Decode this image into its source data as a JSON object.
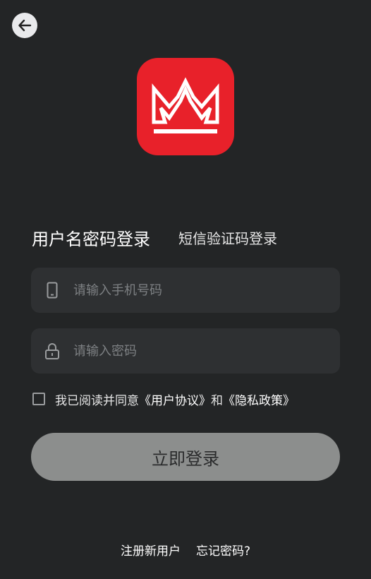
{
  "header": {
    "back_icon": "arrow-left-icon"
  },
  "logo": {
    "icon": "crown-icon",
    "background_color": "#e8212a"
  },
  "tabs": {
    "password_login": "用户名密码登录",
    "sms_login": "短信验证码登录",
    "active": "password_login"
  },
  "form": {
    "phone": {
      "icon": "phone-icon",
      "placeholder": "请输入手机号码",
      "value": ""
    },
    "password": {
      "icon": "lock-icon",
      "placeholder": "请输入密码",
      "value": ""
    }
  },
  "agreement": {
    "checked": false,
    "prefix": "我已阅读并同意",
    "user_agreement": "《用户协议》",
    "conjunction": "和",
    "privacy_policy": "《隐私政策》"
  },
  "login_button": {
    "label": "立即登录"
  },
  "footer": {
    "register": "注册新用户",
    "forgot_password": "忘记密码?"
  }
}
